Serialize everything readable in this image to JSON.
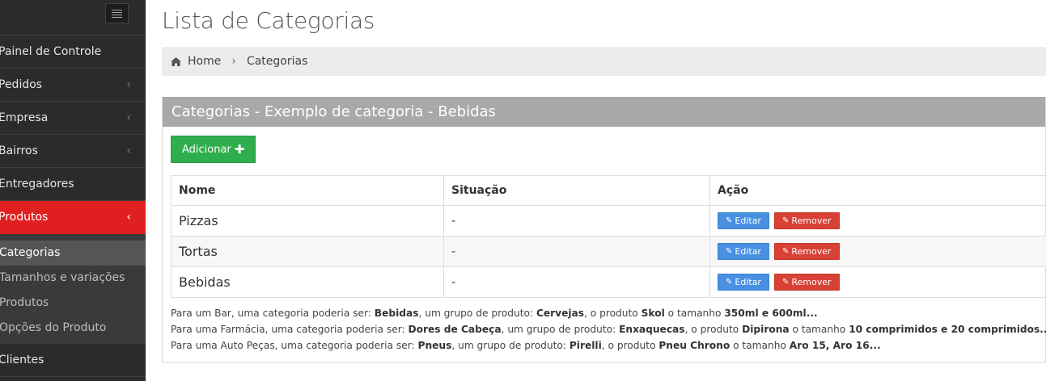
{
  "sidebar": {
    "items": [
      {
        "label": "Painel de Controle",
        "chevron": false
      },
      {
        "label": "Pedidos",
        "chevron": true
      },
      {
        "label": "Empresa",
        "chevron": true
      },
      {
        "label": "Bairros",
        "chevron": true
      },
      {
        "label": "Entregadores",
        "chevron": false
      },
      {
        "label": "Produtos",
        "chevron": true,
        "active": true
      }
    ],
    "submenu": [
      "Categorias",
      "Tamanhos e variações",
      "Produtos",
      "Opções do Produto"
    ],
    "after": {
      "label": "Clientes"
    },
    "chevron_glyph": "‹",
    "active_color": "#e02020"
  },
  "page": {
    "title": "Lista de Categorias"
  },
  "breadcrumb": {
    "home": "Home",
    "separator": "›",
    "current": "Categorias"
  },
  "panel": {
    "heading": "Categorias - Exemplo de categoria - Bebidas",
    "add_label": "Adicionar",
    "add_icon": "plus-icon"
  },
  "table": {
    "headers": [
      "Nome",
      "Situação",
      "Ação"
    ],
    "rows": [
      {
        "nome": "Pizzas",
        "situacao": "-"
      },
      {
        "nome": "Tortas",
        "situacao": "-"
      },
      {
        "nome": "Bebidas",
        "situacao": "-"
      }
    ],
    "edit_label": "Editar",
    "remove_label": "Remover"
  },
  "notes": {
    "lines": [
      {
        "p1": "Para um Bar, uma categoria poderia ser: ",
        "b1": "Bebidas",
        "p2": ", um grupo de produto: ",
        "b2": "Cervejas",
        "p3": ", o produto ",
        "b3": "Skol",
        "p4": " o tamanho ",
        "b4": "350ml e 600ml..."
      },
      {
        "p1": "Para uma Farmácia, uma categoria poderia ser: ",
        "b1": "Dores de Cabeça",
        "p2": ", um grupo de produto: ",
        "b2": "Enxaquecas",
        "p3": ", o produto ",
        "b3": "Dipirona",
        "p4": " o tamanho ",
        "b4": "10 comprimidos e 20 comprimidos..."
      },
      {
        "p1": "Para uma Auto Peças, uma categoria poderia ser: ",
        "b1": "Pneus",
        "p2": ", um grupo de produto: ",
        "b2": "Pirelli",
        "p3": ", o produto ",
        "b3": "Pneu Chrono",
        "p4": " o tamanho ",
        "b4": "Aro 15, Aro 16..."
      }
    ]
  }
}
